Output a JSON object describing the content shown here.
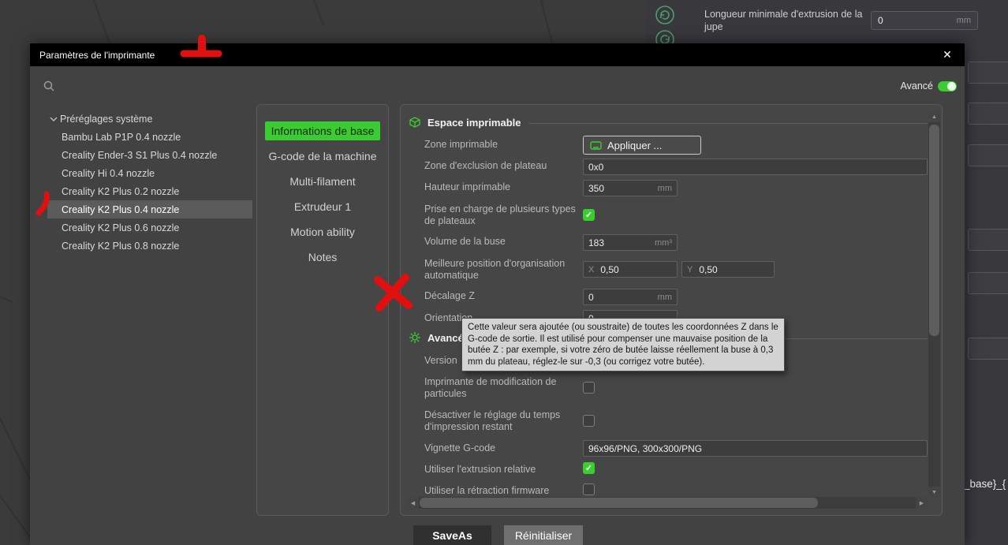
{
  "colors": {
    "accent_green": "#3bcc31",
    "annotation_red": "#e01010",
    "dialog_titlebar": "#000000",
    "tooltip_bg": "#d3d3d3"
  },
  "background": {
    "skirt_label": "Longueur minimale d'extrusion de la jupe",
    "skirt_value": "0",
    "skirt_unit": "mm",
    "partial_code_text": "_base}_{"
  },
  "dialog": {
    "title": "Paramètres de l'imprimante",
    "close_glyph": "✕",
    "advanced_label": "Avancé",
    "tree": {
      "root_label": "Préréglages système",
      "items": [
        "Bambu Lab P1P 0.4 nozzle",
        "Creality Ender-3 S1 Plus 0.4 nozzle",
        "Creality Hi 0.4 nozzle",
        "Creality K2 Plus 0.2 nozzle",
        "Creality K2 Plus 0.4 nozzle",
        "Creality K2 Plus 0.6 nozzle",
        "Creality K2 Plus 0.8 nozzle"
      ],
      "selected_item": "Creality K2 Plus 0.4 nozzle"
    },
    "tabs": [
      "Informations de base",
      "G-code de la machine",
      "Multi-filament",
      "Extrudeur 1",
      "Motion ability",
      "Notes"
    ],
    "selected_tab": "Informations de base",
    "settings": {
      "section_printable_space": "Espace imprimable",
      "section_advanced": "Avancé",
      "printable_area": {
        "label": "Zone imprimable",
        "button_label": "Appliquer ..."
      },
      "bed_exclude_area": {
        "label": "Zone d'exclusion de plateau",
        "value": "0x0"
      },
      "printable_height": {
        "label": "Hauteur imprimable",
        "value": "350",
        "unit": "mm"
      },
      "multi_bed_support": {
        "label": "Prise en charge de plusieurs types de plateaux",
        "checked": true
      },
      "nozzle_volume": {
        "label": "Volume de la buse",
        "value": "183",
        "unit": "mm³"
      },
      "best_position": {
        "label": "Meilleure position d'organisation automatique",
        "x_label": "X",
        "x_value": "0,50",
        "y_label": "Y",
        "y_value": "0,50"
      },
      "z_offset": {
        "label": "Décalage Z",
        "value": "0",
        "unit": "mm"
      },
      "orientation": {
        "label": "Orientation",
        "value": "0"
      },
      "version": {
        "label": "Version"
      },
      "particle_modification": {
        "label": "Imprimante de modification de particules",
        "checked": false
      },
      "disable_remaining_time": {
        "label": "Désactiver le réglage du temps d'impression restant",
        "checked": false
      },
      "gcode_thumbnail": {
        "label": "Vignette G-code",
        "value": "96x96/PNG, 300x300/PNG"
      },
      "relative_extrusion": {
        "label": "Utiliser l'extrusion relative",
        "checked": true
      },
      "firmware_retraction": {
        "label": "Utiliser la rétraction firmware",
        "checked": false
      }
    },
    "tooltip": "Cette valeur sera ajoutée (ou soustraite) de toutes les coordonnées Z dans le G-code de sortie. Il est utilisé pour compenser une mauvaise position de la butée Z : par exemple, si votre zéro de butée laisse réellement la buse à 0,3 mm du plateau, réglez-le sur -0,3 (ou corrigez votre butée).",
    "buttons": {
      "save_as": "SaveAs",
      "reset": "Réinitialiser"
    }
  }
}
